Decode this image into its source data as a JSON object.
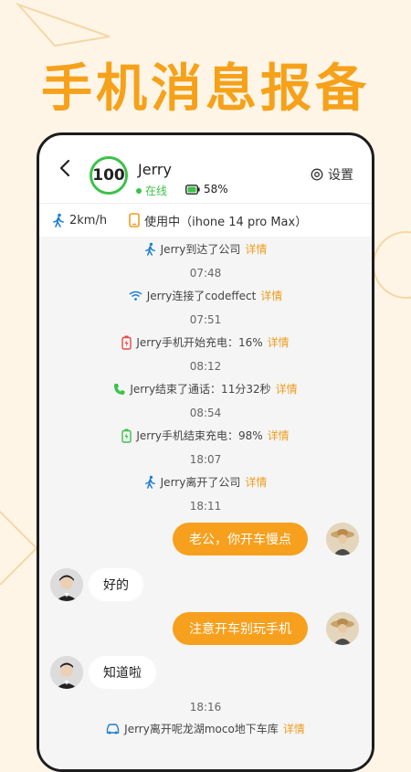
{
  "headline": "手机消息报备",
  "profile": {
    "score": "100",
    "name": "Jerry",
    "status": "在线",
    "battery": "58%",
    "settings": "设置"
  },
  "info": {
    "speed": "2km/h",
    "usage": "使用中（ihone 14 pro Max）"
  },
  "detail_label": "详情",
  "messages": {
    "e0": "Jerry到达了公司",
    "t1": "07:48",
    "e1": "Jerry连接了codeffect",
    "t2": "07:51",
    "e2": "Jerry手机开始充电：16%",
    "t3": "08:12",
    "e3": "Jerry结束了通话：11分32秒",
    "t4": "08:54",
    "e4": "Jerry手机结束充电：98%",
    "t5": "18:07",
    "e5": "Jerry离开了公司",
    "t6": "18:11",
    "m1": "老公，你开车慢点",
    "m2": "好的",
    "m3": "注意开车别玩手机",
    "m4": "知道啦",
    "t7": "18:16",
    "e6": "Jerry离开呢龙湖moco地下车库"
  },
  "colors": {
    "accent": "#f6a01e",
    "online": "#3cc24a",
    "background": "#fff5e6",
    "battery_low": "#e94848"
  },
  "icons": [
    "back-icon",
    "online-dot",
    "battery-icon",
    "settings-gear-icon",
    "walk-icon",
    "phone-device-icon",
    "wifi-icon",
    "charging-low-icon",
    "call-icon",
    "charging-full-icon",
    "car-icon"
  ]
}
